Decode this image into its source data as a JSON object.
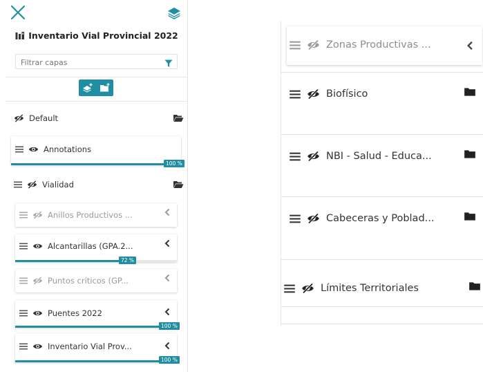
{
  "left": {
    "title": "Inventario Vial Provincial 2022",
    "filter": {
      "placeholder": "Filtrar capas",
      "value": ""
    },
    "groups": [
      {
        "label": "Default",
        "visible": false
      },
      {
        "label": "Vialidad",
        "visible": false
      }
    ],
    "layers": [
      {
        "label": "Annotations",
        "visible": true,
        "progress": 100,
        "progress_label": "100 %"
      },
      {
        "label": "Anillos Productivos ...",
        "visible": false
      },
      {
        "label": "Alcantarillas (GPA.2...",
        "visible": true,
        "progress": 72,
        "progress_label": "72 %"
      },
      {
        "label": "Puntos críticos (GP...",
        "visible": false
      },
      {
        "label": "Puentes 2022",
        "visible": true,
        "progress": 100,
        "progress_label": "100 %"
      },
      {
        "label": "Inventario Vial Prov...",
        "visible": true,
        "progress": 100,
        "progress_label": "100 %"
      }
    ]
  },
  "right": {
    "items": [
      {
        "label": "Zonas Productivas ...",
        "visible": false,
        "dim": true,
        "expand": "chevron"
      },
      {
        "label": "Biofísico",
        "visible": false,
        "expand": "folder"
      },
      {
        "label": "NBI - Salud - Educa...",
        "visible": false,
        "expand": "folder"
      },
      {
        "label": "Cabeceras y Poblad...",
        "visible": false,
        "expand": "folder"
      },
      {
        "label": "Límites Territoriales",
        "visible": false,
        "expand": "folder"
      }
    ]
  },
  "colors": {
    "accent": "#1f8ea3",
    "text": "#333333",
    "dim_text": "#9a9a9a"
  },
  "icons": [
    "close-icon",
    "layers-stack-icon",
    "map-icon",
    "filter-icon",
    "add-layer-icon",
    "add-folder-icon",
    "drag-handle-icon",
    "eye-icon",
    "eye-slash-icon",
    "folder-open-icon",
    "folder-icon",
    "chevron-left-icon"
  ]
}
